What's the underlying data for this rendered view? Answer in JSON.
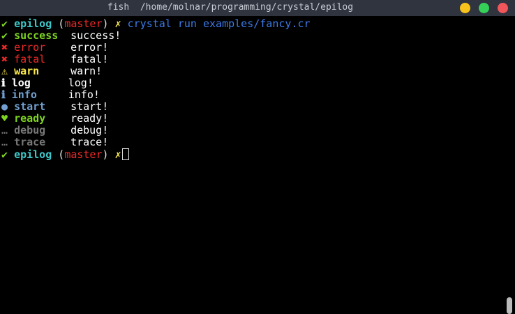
{
  "window": {
    "title": "fish  /home/molnar/programming/crystal/epilog"
  },
  "prompt": {
    "check": "✔",
    "dir": "epilog",
    "branch_open": "(",
    "branch": "master",
    "branch_close": ")",
    "dirty": "✗",
    "command": "crystal run examples/fancy.cr"
  },
  "log_lines": [
    {
      "icon": "✔",
      "level": "success",
      "message": "success!"
    },
    {
      "icon": "✖",
      "level": "error",
      "message": "error!"
    },
    {
      "icon": "✖",
      "level": "fatal",
      "message": "fatal!"
    },
    {
      "icon": "⚠",
      "level": "warn",
      "message": "warn!"
    },
    {
      "icon": "ℹ",
      "level": "log",
      "message": "log!"
    },
    {
      "icon": "ℹ",
      "level": "info",
      "message": "info!"
    },
    {
      "icon": "●",
      "level": "start",
      "message": "start!"
    },
    {
      "icon": "♥",
      "level": "ready",
      "message": "ready!"
    },
    {
      "icon": "…",
      "level": "debug",
      "message": "debug!"
    },
    {
      "icon": "…",
      "level": "trace",
      "message": "trace!"
    }
  ],
  "colors": {
    "titlebar": "#2f343f",
    "minimize": "#f6c21b",
    "maximize": "#34d058",
    "close": "#f2555a"
  }
}
